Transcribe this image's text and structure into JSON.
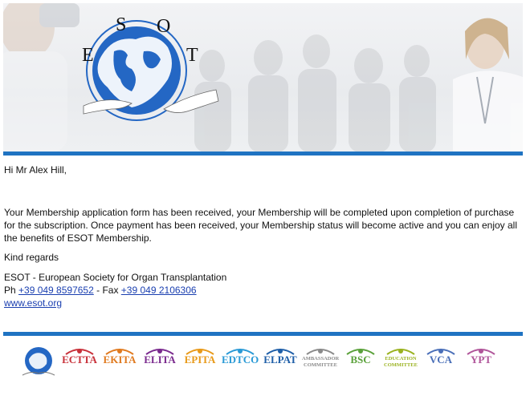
{
  "header": {
    "logo_letters": [
      "E",
      "S",
      "O",
      "T"
    ],
    "colors": {
      "accent_blue": "#1f73c2",
      "map_blue": "#2467c4",
      "link": "#1a3fb0"
    }
  },
  "email": {
    "greeting": "Hi Mr Alex Hill,",
    "body": "Your Membership application form has been received, your Membership will be completed upon completion of purchase for the subscription. Once payment has been received, your Membership status will become active and you can enjoy all the benefits of ESOT Membership.",
    "closing": "Kind regards",
    "org_line": "ESOT - European Society for Organ Transplantation",
    "phone_prefix": "Ph ",
    "phone": "+39 049 8597652",
    "fax_prefix": " - Fax ",
    "fax": "+39 049 2106306",
    "website": "www.esot.org"
  },
  "footer": {
    "logos": [
      {
        "name": "ECTTA",
        "color": "#c8313a"
      },
      {
        "name": "EKITA",
        "color": "#e07a1f"
      },
      {
        "name": "ELITA",
        "color": "#7a2a8e"
      },
      {
        "name": "EPITA",
        "color": "#e89a1a"
      },
      {
        "name": "EDTCO",
        "color": "#2a9ad6"
      },
      {
        "name": "ELPAT",
        "color": "#1f5fa8"
      },
      {
        "name": "AMBASSADOR COMMITTEE",
        "color": "#8a8a8a"
      },
      {
        "name": "BSC",
        "color": "#5aa13a"
      },
      {
        "name": "EDUCATION COMMITTEE",
        "color": "#9ab21f"
      },
      {
        "name": "VCA",
        "color": "#4a6fb8"
      },
      {
        "name": "YPT",
        "color": "#b0559a"
      }
    ]
  }
}
